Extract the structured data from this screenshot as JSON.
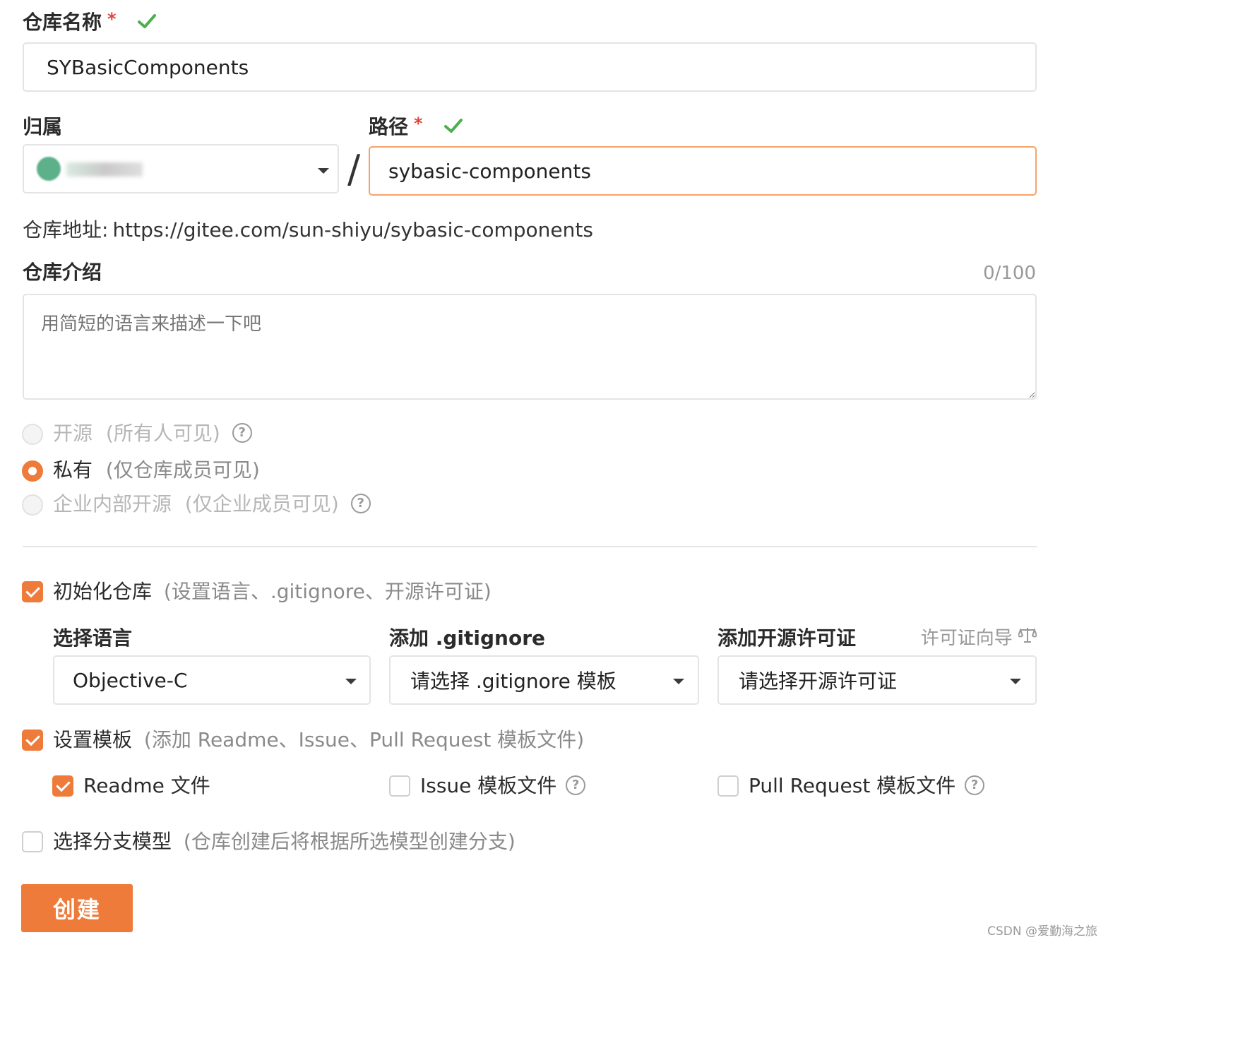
{
  "repo_name": {
    "label": "仓库名称",
    "required_mark": "*",
    "value": "SYBasicComponents"
  },
  "owner": {
    "label": "归属",
    "selected_value": ""
  },
  "separator": "/",
  "path": {
    "label": "路径",
    "required_mark": "*",
    "value": "sybasic-components"
  },
  "repo_address": {
    "label": "仓库地址:",
    "url": "https://gitee.com/sun-shiyu/sybasic-components"
  },
  "intro": {
    "label": "仓库介绍",
    "counter": "0/100",
    "placeholder": "用简短的语言来描述一下吧"
  },
  "visibility": {
    "options": [
      {
        "label": "开源",
        "hint": "(所有人可见)",
        "selected": false,
        "disabled": true,
        "help": true
      },
      {
        "label": "私有",
        "hint": "(仅仓库成员可见)",
        "selected": true,
        "disabled": false,
        "help": false
      },
      {
        "label": "企业内部开源",
        "hint": "(仅企业成员可见)",
        "selected": false,
        "disabled": true,
        "help": true
      }
    ]
  },
  "init_repo": {
    "label": "初始化仓库",
    "hint": "(设置语言、.gitignore、开源许可证)",
    "checked": true
  },
  "language": {
    "label": "选择语言",
    "value": "Objective-C"
  },
  "gitignore": {
    "label": "添加 .gitignore",
    "value": "请选择 .gitignore 模板"
  },
  "license": {
    "label": "添加开源许可证",
    "wizard_link": "许可证向导",
    "value": "请选择开源许可证"
  },
  "templates": {
    "label": "设置模板",
    "hint": "(添加 Readme、Issue、Pull Request 模板文件)",
    "checked": true,
    "items": [
      {
        "label": "Readme 文件",
        "checked": true,
        "help": false
      },
      {
        "label": "Issue 模板文件",
        "checked": false,
        "help": true
      },
      {
        "label": "Pull Request 模板文件",
        "checked": false,
        "help": true
      }
    ]
  },
  "branch_model": {
    "label": "选择分支模型",
    "hint": "(仓库创建后将根据所选模型创建分支)",
    "checked": false
  },
  "create_button": "创建",
  "watermark": "CSDN @爱勤海之旅",
  "help_glyph": "?",
  "colors": {
    "accent": "#ef7b3a",
    "success": "#4caf50",
    "required": "#e0453a",
    "focus_border": "#f6a26a"
  }
}
